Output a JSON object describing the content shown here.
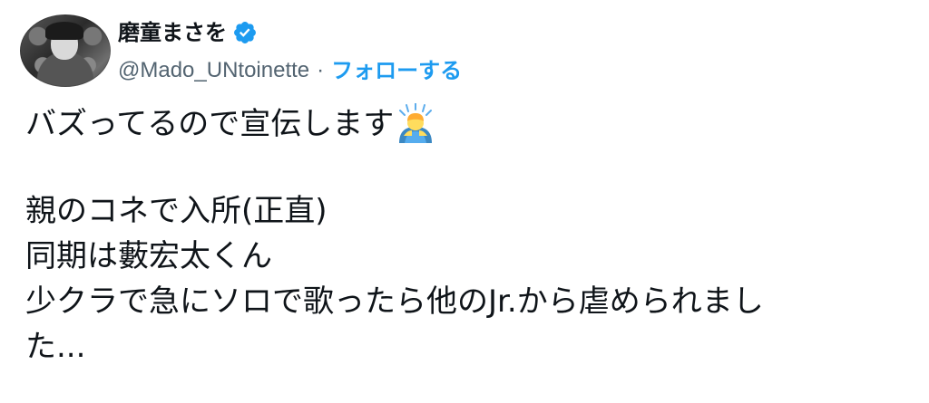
{
  "author": {
    "display_name": "磨童まさを",
    "handle": "@Mado_UNtoinette",
    "separator": "·",
    "follow_label": "フォローする",
    "verified": true,
    "accent_color": "#1d9bf0"
  },
  "tweet": {
    "line1": "バズってるので宣伝します",
    "line1_emoji": "person-bowing-emoji",
    "line2": "親のコネで入所(正直)",
    "line3": "同期は藪宏太くん",
    "line4": "少クラで急にソロで歌ったら他のJr.から虐められまし",
    "line5": "た..."
  }
}
